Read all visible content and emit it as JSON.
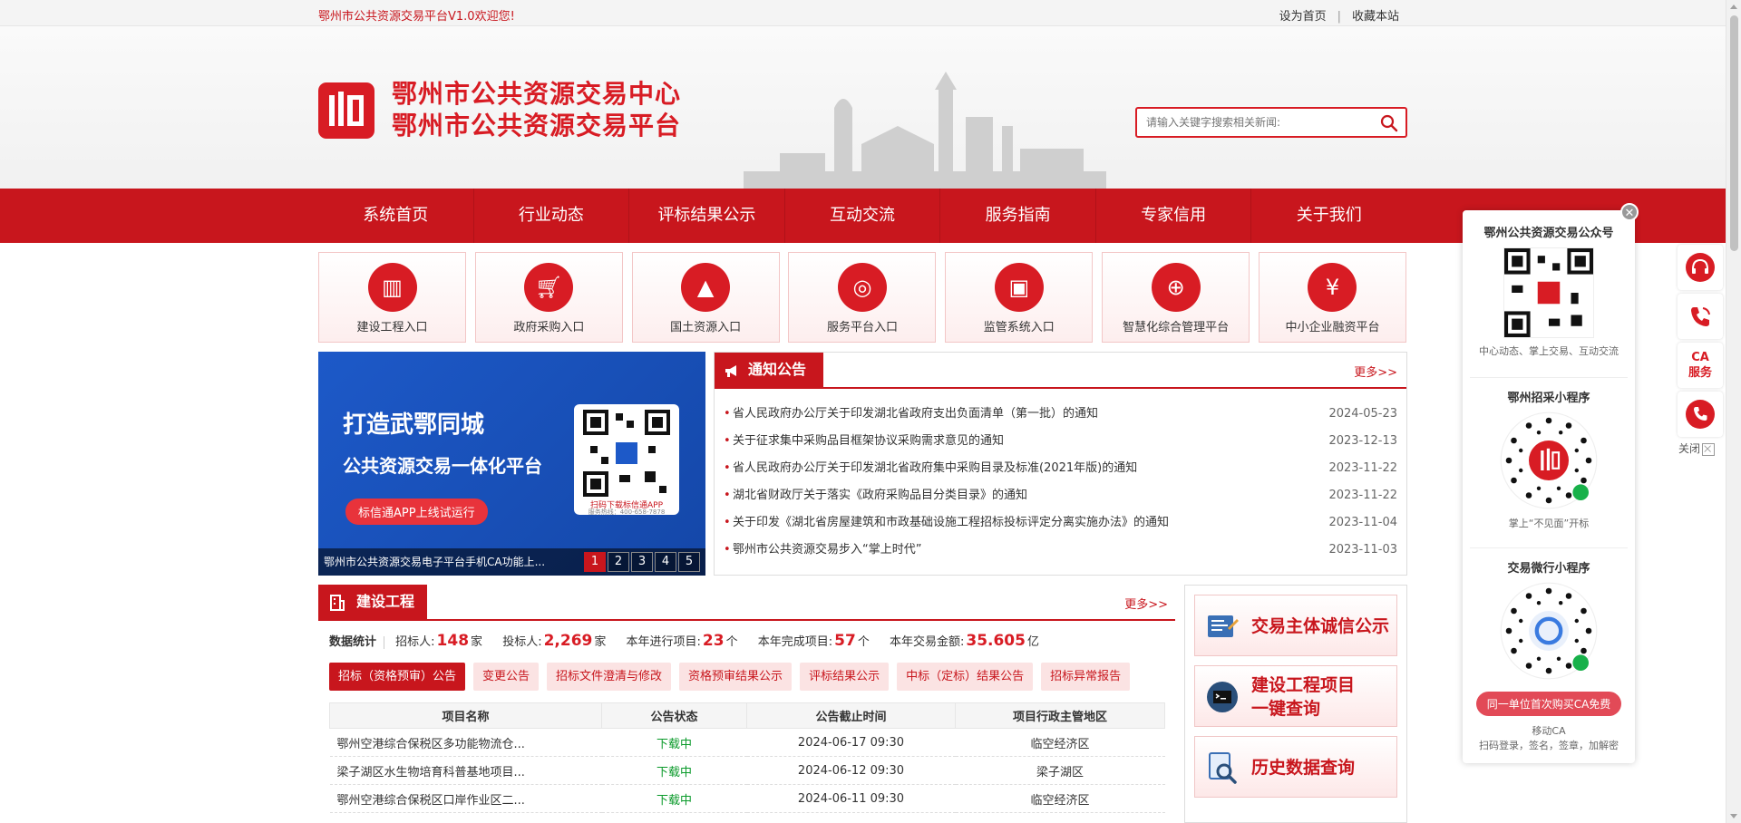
{
  "topbar": {
    "welcome": "鄂州市公共资源交易平台V1.0欢迎您!",
    "set_home": "设为首页",
    "separator": "|",
    "bookmark": "收藏本站"
  },
  "header": {
    "title_line1": "鄂州市公共资源交易中心",
    "title_line2": "鄂州市公共资源交易平台",
    "search_placeholder": "请输入关键字搜索相关新闻:",
    "brand_color": "#d81c24"
  },
  "nav": {
    "items": [
      "系统首页",
      "行业动态",
      "评标结果公示",
      "互动交流",
      "服务指南",
      "专家信用",
      "关于我们"
    ]
  },
  "entries": [
    {
      "label": "建设工程入口",
      "icon": "building-icon"
    },
    {
      "label": "政府采购入口",
      "icon": "cart-icon"
    },
    {
      "label": "国土资源入口",
      "icon": "mountain-icon"
    },
    {
      "label": "服务平台入口",
      "icon": "emblem-icon"
    },
    {
      "label": "监管系统入口",
      "icon": "monitor-icon"
    },
    {
      "label": "智慧化综合管理平台",
      "icon": "globe-icon"
    },
    {
      "label": "中小企业融资平台",
      "icon": "money-hand-icon"
    }
  ],
  "banner": {
    "headline": "打造武鄂同城",
    "subhead": "公共资源交易一体化平台",
    "pill": "标信通APP上线试运行",
    "qr_caption": "扫码下载标信通APP",
    "qr_hotline": "服务热线：400-658-7878",
    "caption": "鄂州市公共资源交易电子平台手机CA功能上...",
    "pages": [
      "1",
      "2",
      "3",
      "4",
      "5"
    ]
  },
  "notice": {
    "title": "通知公告",
    "more": "更多>>",
    "items": [
      {
        "title": "省人民政府办公厅关于印发湖北省政府支出负面清单（第一批）的通知",
        "date": "2024-05-23"
      },
      {
        "title": "关于征求集中采购品目框架协议采购需求意见的通知",
        "date": "2023-12-13"
      },
      {
        "title": "省人民政府办公厅关于印发湖北省政府集中采购目录及标准(2021年版)的通知",
        "date": "2023-11-22"
      },
      {
        "title": "湖北省财政厅关于落实《政府采购品目分类目录》的通知",
        "date": "2023-11-22"
      },
      {
        "title": "关于印发《湖北省房屋建筑和市政基础设施工程招标投标评定分离实施办法》的通知",
        "date": "2023-11-04"
      },
      {
        "title": "鄂州市公共资源交易步入“掌上时代”",
        "date": "2023-11-03"
      }
    ]
  },
  "construction": {
    "title": "建设工程",
    "more": "更多>>",
    "stats_label": "数据统计",
    "stats": [
      {
        "label": "招标人:",
        "value": "148",
        "unit": "家"
      },
      {
        "label": "投标人:",
        "value": "2,269",
        "unit": "家"
      },
      {
        "label": "本年进行项目:",
        "value": "23",
        "unit": "个"
      },
      {
        "label": "本年完成项目:",
        "value": "57",
        "unit": "个"
      },
      {
        "label": "本年交易金额:",
        "value": "35.605",
        "unit": "亿"
      }
    ],
    "tabs": [
      "招标（资格预审）公告",
      "变更公告",
      "招标文件澄清与修改",
      "资格预审结果公示",
      "评标结果公示",
      "中标（定标）结果公告",
      "招标异常报告"
    ],
    "columns": [
      "项目名称",
      "公告状态",
      "公告截止时间",
      "项目行政主管地区"
    ],
    "rows": [
      {
        "name": "鄂州空港综合保税区多功能物流仓...",
        "status": "下载中",
        "deadline": "2024-06-17 09:30",
        "region": "临空经济区"
      },
      {
        "name": "梁子湖区水生物培育科普基地项目...",
        "status": "下载中",
        "deadline": "2024-06-12 09:30",
        "region": "梁子湖区"
      },
      {
        "name": "鄂州空港综合保税区口岸作业区二...",
        "status": "下载中",
        "deadline": "2024-06-11 09:30",
        "region": "临空经济区"
      }
    ]
  },
  "right_buttons": [
    {
      "label": "交易主体诚信公示",
      "icon": "document-icon"
    },
    {
      "label_line1": "建设工程项目",
      "label_line2": "一键查询",
      "icon": "terminal-icon"
    },
    {
      "label": "历史数据查询",
      "icon": "search-doc-icon"
    }
  ],
  "qr_panel": {
    "close": "✕",
    "sec1_title": "鄂州公共资源交易公众号",
    "sec1_sub": "中心动态、掌上交易、互动交流",
    "sec2_title": "鄂州招采小程序",
    "sec2_sub": "掌上“不见面”开标",
    "sec3_title": "交易微行小程序",
    "sec3_pill": "同一单位首次购买CA免费",
    "sec3_sub1": "移动CA",
    "sec3_sub2": "扫码登录，签名，签章，加解密"
  },
  "side_icons": {
    "ca_line1": "CA",
    "ca_line2": "服务",
    "close": "关闭"
  }
}
